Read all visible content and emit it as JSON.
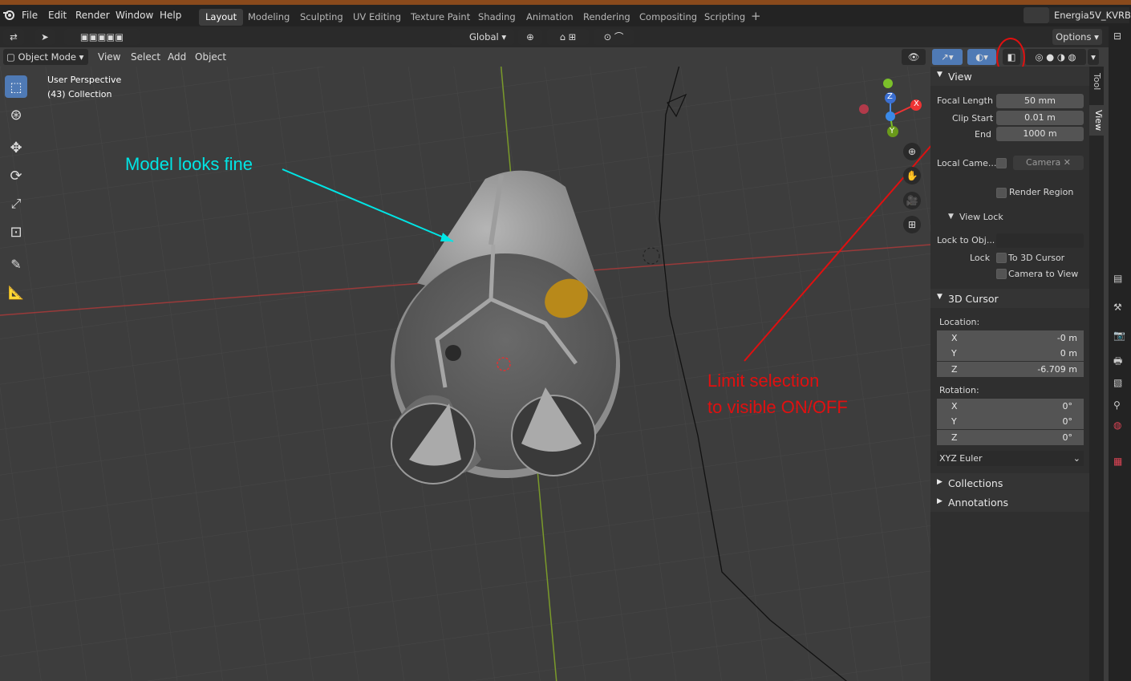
{
  "menu": {
    "file": "File",
    "edit": "Edit",
    "render": "Render",
    "window": "Window",
    "help": "Help"
  },
  "workspaces": [
    "Layout",
    "Modeling",
    "Sculpting",
    "UV Editing",
    "Texture Paint",
    "Shading",
    "Animation",
    "Rendering",
    "Compositing",
    "Scripting"
  ],
  "active_workspace": "Layout",
  "scene_name": "Energia5V_KVRB",
  "header": {
    "orientation": "Global",
    "options": "Options",
    "mode": "Object Mode",
    "view": "View",
    "select": "Select",
    "add": "Add",
    "object": "Object"
  },
  "viewport": {
    "perspective": "User Perspective",
    "collection": "(43) Collection"
  },
  "annotations": {
    "model_note": "Model looks fine",
    "limit_line1": "Limit selection",
    "limit_line2": "to visible ON/OFF",
    "note_color": "#00e5e5",
    "limit_color": "#e01010"
  },
  "gizmo": {
    "x": "X",
    "y": "Y",
    "z": "Z"
  },
  "npanel": {
    "view_title": "View",
    "focal_label": "Focal Length",
    "focal_value": "50 mm",
    "clip_start_label": "Clip Start",
    "clip_start_value": "0.01 m",
    "end_label": "End",
    "end_value": "1000 m",
    "local_camera_label": "Local Came...",
    "camera_value": "Camera",
    "render_region": "Render Region",
    "view_lock_title": "View Lock",
    "lock_to_obj_label": "Lock to Obj...",
    "lock_label": "Lock",
    "to_3d_cursor": "To 3D Cursor",
    "camera_to_view": "Camera to View",
    "cursor_title": "3D Cursor",
    "location_label": "Location:",
    "loc": [
      {
        "axis": "X",
        "value": "-0 m"
      },
      {
        "axis": "Y",
        "value": "0 m"
      },
      {
        "axis": "Z",
        "value": "-6.709 m"
      }
    ],
    "rotation_label": "Rotation:",
    "rot": [
      {
        "axis": "X",
        "value": "0°"
      },
      {
        "axis": "Y",
        "value": "0°"
      },
      {
        "axis": "Z",
        "value": "0°"
      }
    ],
    "rotation_mode": "XYZ Euler",
    "collections_title": "Collections",
    "annotations_title": "Annotations",
    "tab_tool": "Tool",
    "tab_view": "View"
  }
}
